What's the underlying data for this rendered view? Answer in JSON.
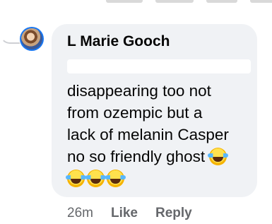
{
  "comment": {
    "author": "L Marie Gooch",
    "text_lines": [
      "disappearing too not",
      "from ozempic but a",
      "lack of melanin Casper",
      "no so friendly ghost"
    ],
    "emoji_icons": [
      "rolling-on-floor-laughing",
      "rolling-on-floor-laughing",
      "rolling-on-floor-laughing",
      "rolling-on-floor-laughing"
    ],
    "timestamp": "26m",
    "like_label": "Like",
    "reply_label": "Reply"
  },
  "colors": {
    "bubble": "#f0f2f5",
    "meta_text": "#65676b",
    "avatar_ring": "#1877f2"
  }
}
